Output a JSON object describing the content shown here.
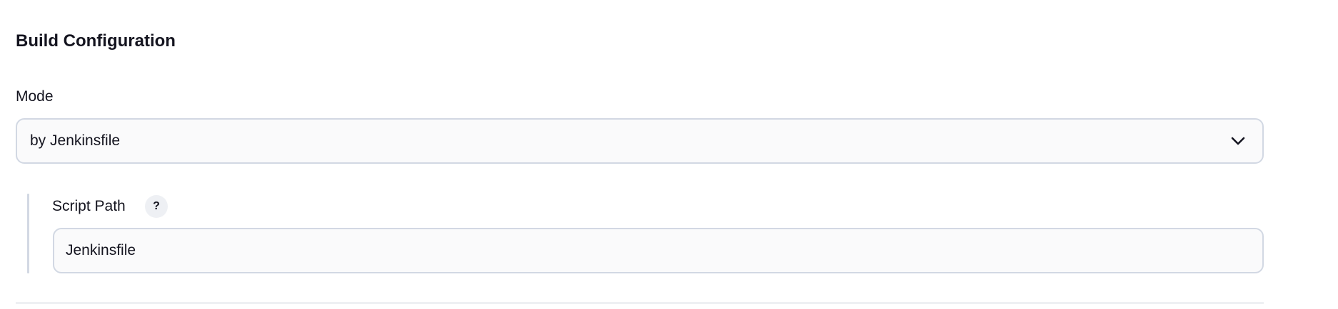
{
  "section": {
    "title": "Build Configuration"
  },
  "mode": {
    "label": "Mode",
    "selected": "by Jenkinsfile"
  },
  "script_path": {
    "label": "Script Path",
    "help": "?",
    "value": "Jenkinsfile"
  },
  "icons": {
    "dropdown": "chevron-down-icon"
  }
}
